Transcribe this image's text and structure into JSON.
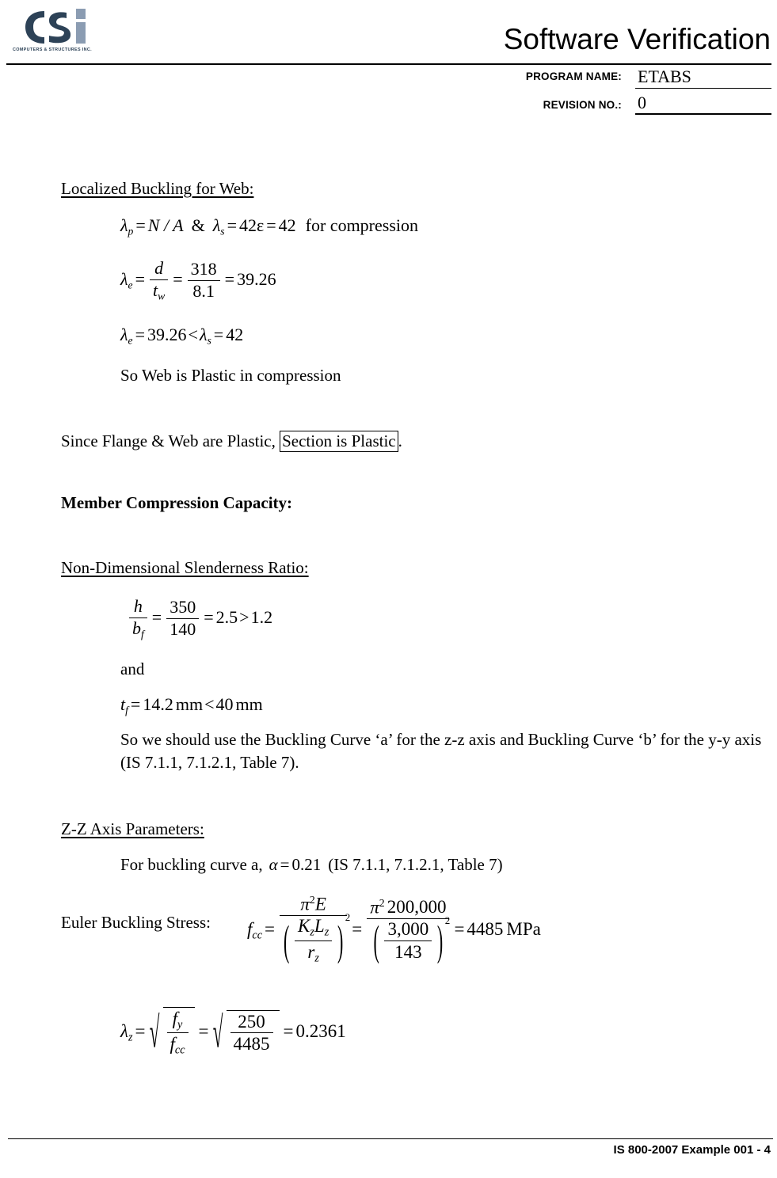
{
  "header": {
    "logo_alt": "Computers & Structures Inc.",
    "logo_tagline": "COMPUTERS & STRUCTURES INC.",
    "title": "Software Verification",
    "program_name_label": "PROGRAM NAME:",
    "program_name_value": "ETABS",
    "revision_label": "REVISION NO.:",
    "revision_value": "0",
    "logo_dark_color": "#2d4257",
    "logo_light_color": "#8b9cb2"
  },
  "body": {
    "section_web_heading": "Localized Buckling for Web:",
    "eq_lambda_p": {
      "lhs_sym": "λ",
      "lhs_sub": "p",
      "eq1": "=",
      "rhs1": "N / A",
      "amp": "&",
      "sym2": "λ",
      "sub2": "s",
      "eq2": "=",
      "val2a": "42ε",
      "eq3": "=",
      "val2b": "42",
      "trail": "for compression"
    },
    "eq_lambda_e_frac": {
      "sym": "λ",
      "sub": "e",
      "eq1": "=",
      "num1": "d",
      "den1": "t",
      "den1_sub": "w",
      "eq2": "=",
      "num2": "318",
      "den2": "8.1",
      "eq3": "=",
      "result": "39.26"
    },
    "eq_lambda_compare": {
      "sym1": "λ",
      "sub1": "e",
      "eq1": "=",
      "v1": "39.26",
      "lt": "<",
      "sym2": "λ",
      "sub2": "s",
      "eq2": "=",
      "v2": "42"
    },
    "web_plastic_text": "So Web is Plastic in compression",
    "since_flange_prefix": "Since Flange & Web are Plastic, ",
    "since_flange_boxed": "Section is Plastic",
    "since_flange_suffix": ".",
    "member_capacity_heading": "Member Compression Capacity:",
    "slenderness_heading": "Non-Dimensional Slenderness Ratio:",
    "eq_h_bf": {
      "num1": "h",
      "den1": "b",
      "den1_sub": "f",
      "eq1": "=",
      "num2": "350",
      "den2": "140",
      "eq2": "=",
      "v1": "2.5",
      "gt": ">",
      "v2": "1.2"
    },
    "and_text": "and",
    "eq_tf": {
      "sym": "t",
      "sub": "f",
      "eq": "=",
      "v1": "14.2",
      "u1": "mm",
      "lt": "<",
      "v2": "40",
      "u2": "mm"
    },
    "buckling_curve_para": "So we should use the Buckling Curve ‘a’ for the z-z axis and Buckling Curve ‘b’ for the y-y axis (IS 7.1.1, 7.1.2.1, Table 7).",
    "zz_axis_heading": "Z-Z Axis Parameters:",
    "for_buckling_curve": {
      "prefix": "For buckling curve a,",
      "alpha": "α",
      "eq": "=",
      "value": "0.21",
      "ref": "(IS 7.1.1, 7.1.2.1, Table 7)"
    },
    "euler_label": "Euler Buckling Stress:",
    "eq_fcc": {
      "sym": "f",
      "sub": "cc",
      "eq1": "=",
      "num1_pi": "π",
      "num1_sup": "2",
      "num1_var": "E",
      "den1_num_k": "K",
      "den1_num_ksub": "z",
      "den1_num_l": "L",
      "den1_num_lsub": "z",
      "den1_den_r": "r",
      "den1_den_rsub": "z",
      "paren_sup": "2",
      "eq2": "=",
      "num2_pi": "π",
      "num2_sup": "2",
      "num2_val": "200,000",
      "den2_num": "3,000",
      "den2_den": "143",
      "eq3": "=",
      "result": "4485",
      "unit": "MPa"
    },
    "eq_lambda_z": {
      "sym": "λ",
      "sub": "z",
      "eq1": "=",
      "r1_num": "f",
      "r1_num_sub": "y",
      "r1_den": "f",
      "r1_den_sub": "cc",
      "eq2": "=",
      "r2_num": "250",
      "r2_den": "4485",
      "eq3": "=",
      "result": "0.2361"
    }
  },
  "footer": {
    "text": "IS 800-2007 Example 001 - 4"
  }
}
